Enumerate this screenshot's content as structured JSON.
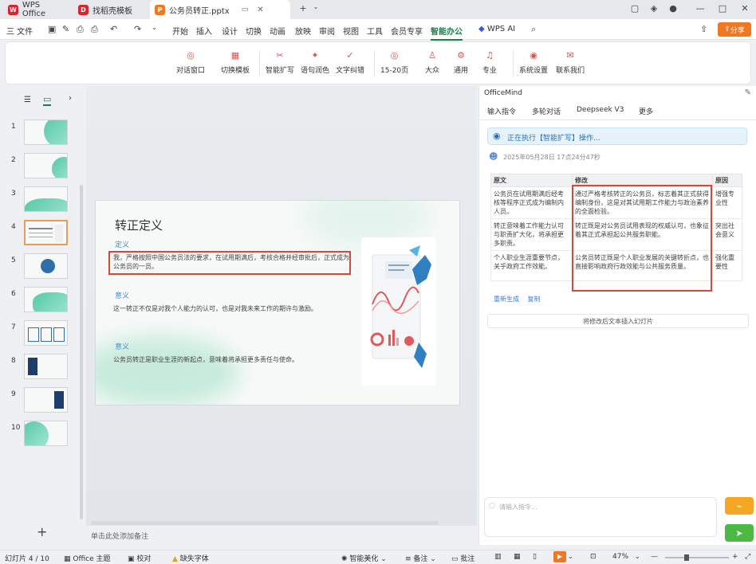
{
  "tabs": [
    {
      "label": "WPS Office",
      "color": "#d7262e"
    },
    {
      "label": "找稻壳模板",
      "color": "#d7262e"
    },
    {
      "label": "公务员转正.pptx",
      "color": "#f07822"
    }
  ],
  "menu": {
    "file_label": "三 文件",
    "items": [
      "开始",
      "插入",
      "设计",
      "切换",
      "动画",
      "放映",
      "审阅",
      "视图",
      "工具",
      "会员专享",
      "智能办公",
      "WPS AI"
    ],
    "active": "智能办公",
    "share_label": "分享"
  },
  "ribbon": {
    "items": [
      "对话窗口",
      "切换模板",
      "智能扩写",
      "语句润色",
      "文字纠错",
      "15-20页",
      "大众",
      "通用",
      "专业",
      "系统设置",
      "联系我们"
    ]
  },
  "slides": {
    "numbers": [
      "1",
      "2",
      "3",
      "4",
      "5",
      "6",
      "7",
      "8",
      "9",
      "10"
    ],
    "selected": "4",
    "add_label": "+"
  },
  "slide": {
    "title": "转正定义",
    "section1_head": "定义",
    "section1_text": "我，严格按照中国公务员法的要求，在试用期满后，考核合格并经审批后，正式成为公务员的一员。",
    "section2_head": "意义",
    "section2_text": "这一转正不仅是对我个人能力的认可，也是对我未来工作的期许与激励。",
    "section3_head": "意义",
    "section3_text": "公务员转正是职业生涯的新起点，意味着将承担更多责任与使命。",
    "notes_placeholder": "单击此处添加备注"
  },
  "officemind": {
    "title": "OfficeMind",
    "tabs": [
      "输入指令",
      "多轮对话",
      "Deepseek V3",
      "更多"
    ],
    "status": "正在执行【智能扩写】操作...",
    "timestamp": "2025年05月28日 17点24分47秒",
    "table": {
      "headers": [
        "原文",
        "修改",
        "原因"
      ],
      "rows": [
        [
          "公务员在试用期满后经考核等程序正式成为编制内人员。",
          "通过严格考核转正的公务员，标志着其正式获得编制身份，这是对其试用期工作能力与政治素养的全面检验。",
          "增强专业性"
        ],
        [
          "转正意味着工作能力认可与职责扩大化，将承担更多职责。",
          "转正既是对公务员试用表现的权威认可，也象征着其正式承担起公共服务职能。",
          "突出社会意义"
        ],
        [
          "个人职业生涯重要节点，关乎政府工作效能。",
          "公务员转正既是个人职业发展的关键转折点，也直接影响政府行政效能与公共服务质量。",
          "强化重要性"
        ]
      ]
    },
    "link_a": "重新生成",
    "link_b": "复制",
    "insert_label": "将修改后文本插入幻灯片",
    "input_placeholder": "请输入指令..."
  },
  "statusbar": {
    "slide_info": "幻灯片 4 / 10",
    "theme": "Office 主题",
    "check": "校对",
    "font": "缺失字体",
    "smart": "智能美化",
    "notes": "备注",
    "comment": "批注",
    "zoom": "47%"
  },
  "colors": {
    "accent": "#1a7f4b",
    "highlight": "#d24a3a",
    "orange": "#f5a623",
    "green": "#4cb944"
  }
}
